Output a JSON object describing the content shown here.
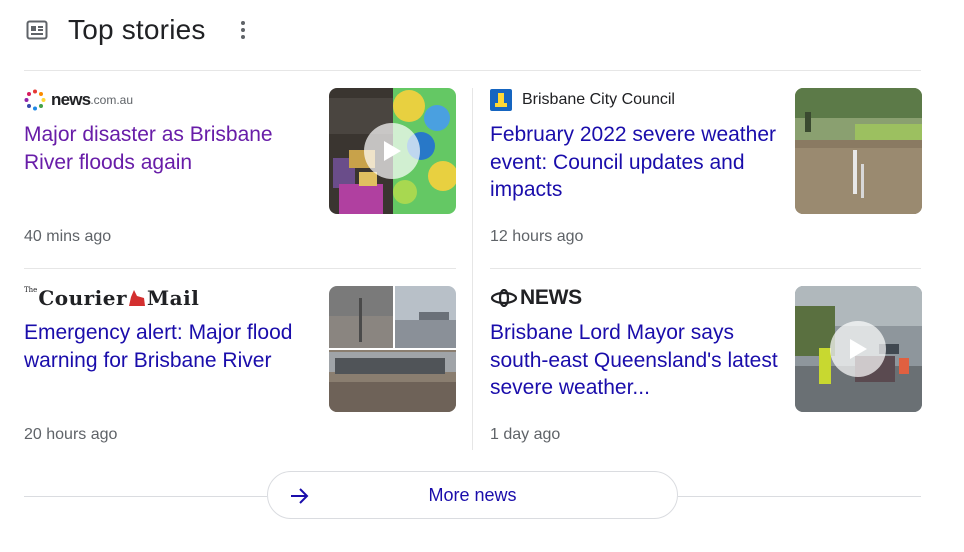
{
  "header": {
    "title": "Top stories"
  },
  "stories": [
    {
      "source": "news.com.au",
      "source_main": "news",
      "source_tld": ".com.au",
      "headline": "Major disaster as Brisbane River floods again",
      "time": "40 mins ago",
      "has_video": true,
      "visited": true
    },
    {
      "source": "Brisbane City Council",
      "headline": "February 2022 severe weather event: Council updates and impacts",
      "time": "12 hours ago",
      "has_video": false,
      "visited": false
    },
    {
      "source": "The Courier Mail",
      "source_small": "The",
      "source_a": "Courier",
      "source_b": "Mail",
      "headline": "Emergency alert: Major flood warning for Brisbane River",
      "time": "20 hours ago",
      "has_video": false,
      "visited": false
    },
    {
      "source": "ABC NEWS",
      "source_text": "NEWS",
      "headline": "Brisbane Lord Mayor says south-east Queensland's latest severe weather...",
      "time": "1 day ago",
      "has_video": true,
      "visited": false
    }
  ],
  "more_button": {
    "label": "More news"
  },
  "colors": {
    "link": "#1a0dab",
    "visited_link": "#681da8",
    "meta": "#5f6368",
    "divider": "#e6e6e6"
  },
  "icons": {
    "section": "newspaper-icon",
    "menu": "more-vert-icon",
    "more": "arrow-right-icon",
    "video": "play-icon"
  }
}
